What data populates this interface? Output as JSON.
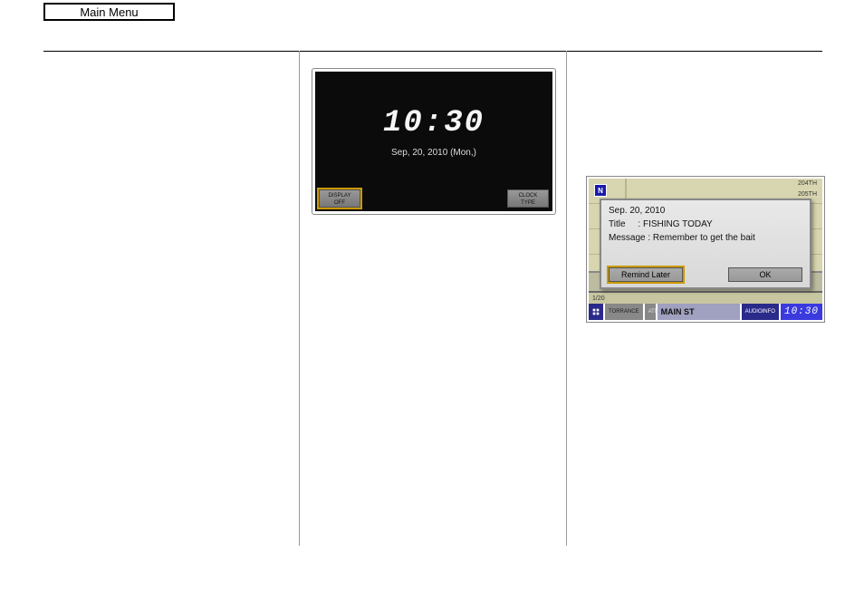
{
  "header": {
    "main_menu_label": "Main Menu"
  },
  "clock_screen": {
    "time": "10:30",
    "date": "Sep, 20, 2010 (Mon,)",
    "buttons": {
      "display_off_l1": "DISPLAY",
      "display_off_l2": "OFF",
      "clock_type_l1": "CLOCK",
      "clock_type_l2": "TYPE"
    }
  },
  "reminder_screen": {
    "compass": "N",
    "road_tag_204th": "204TH",
    "road_tag_205th": "205TH",
    "popup": {
      "date": "Sep. 20, 2010",
      "title_label": "Title",
      "title_value": "FISHING TODAY",
      "message_label": "Message",
      "message_value": "Remember to get the bait",
      "remind_later": "Remind Later",
      "ok": "OK"
    },
    "status_bar": {
      "icon_label": "ICON",
      "torrance": "TORRANCE",
      "atm": "ATM",
      "street": "MAIN ST",
      "audio_l1": "AUDIO",
      "audio_l2": "INFO",
      "time": "10:30"
    },
    "scale": "1/20"
  }
}
